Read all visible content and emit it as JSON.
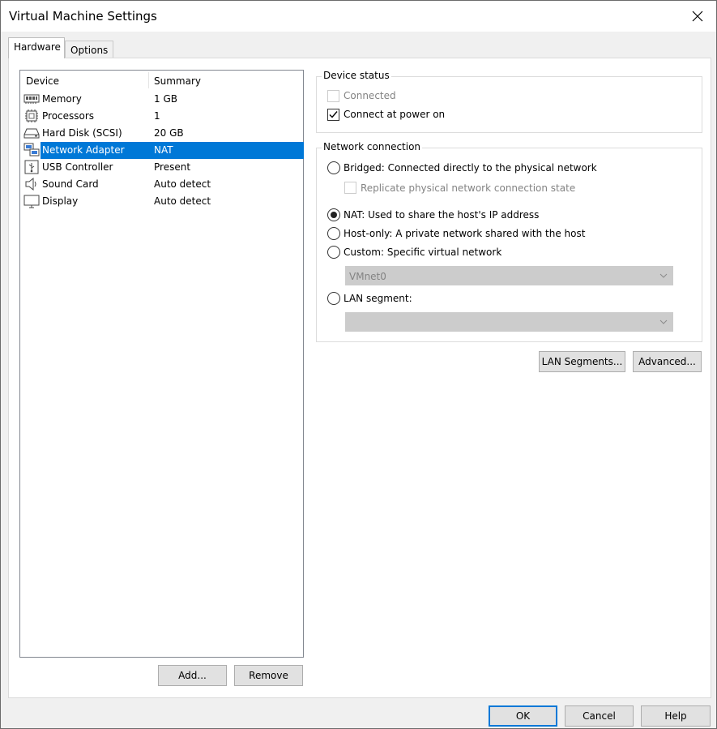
{
  "window": {
    "title": "Virtual Machine Settings"
  },
  "tabs": [
    {
      "label": "Hardware",
      "active": true
    },
    {
      "label": "Options",
      "active": false
    }
  ],
  "device_list": {
    "columns": [
      "Device",
      "Summary"
    ],
    "rows": [
      {
        "icon": "memory-icon",
        "device": "Memory",
        "summary": "1 GB",
        "selected": false
      },
      {
        "icon": "processor-icon",
        "device": "Processors",
        "summary": "1",
        "selected": false
      },
      {
        "icon": "hard-disk-icon",
        "device": "Hard Disk (SCSI)",
        "summary": "20 GB",
        "selected": false
      },
      {
        "icon": "network-adapter-icon",
        "device": "Network Adapter",
        "summary": "NAT",
        "selected": true
      },
      {
        "icon": "usb-icon",
        "device": "USB Controller",
        "summary": "Present",
        "selected": false
      },
      {
        "icon": "speaker-icon",
        "device": "Sound Card",
        "summary": "Auto detect",
        "selected": false
      },
      {
        "icon": "display-icon",
        "device": "Display",
        "summary": "Auto detect",
        "selected": false
      }
    ],
    "add_label": "Add...",
    "remove_label": "Remove"
  },
  "device_status": {
    "title": "Device status",
    "connected": {
      "label": "Connected",
      "checked": false,
      "enabled": false
    },
    "connect_at_power_on": {
      "label": "Connect at power on",
      "checked": true,
      "enabled": true
    }
  },
  "network_connection": {
    "title": "Network connection",
    "bridged": {
      "label": "Bridged: Connected directly to the physical network",
      "selected": false
    },
    "replicate": {
      "label": "Replicate physical network connection state",
      "checked": false,
      "enabled": false
    },
    "nat": {
      "label": "NAT: Used to share the host's IP address",
      "selected": true
    },
    "host_only": {
      "label": "Host-only: A private network shared with the host",
      "selected": false
    },
    "custom": {
      "label": "Custom: Specific virtual network",
      "selected": false
    },
    "custom_select_value": "VMnet0",
    "lan_segment": {
      "label": "LAN segment:",
      "selected": false
    },
    "lan_select_value": ""
  },
  "actions": {
    "lan_segments_label": "LAN Segments...",
    "advanced_label": "Advanced..."
  },
  "footer": {
    "ok_label": "OK",
    "cancel_label": "Cancel",
    "help_label": "Help"
  },
  "colors": {
    "selection": "#0078d7",
    "default_button_border": "#0078d7",
    "disabled_text": "#838383"
  }
}
